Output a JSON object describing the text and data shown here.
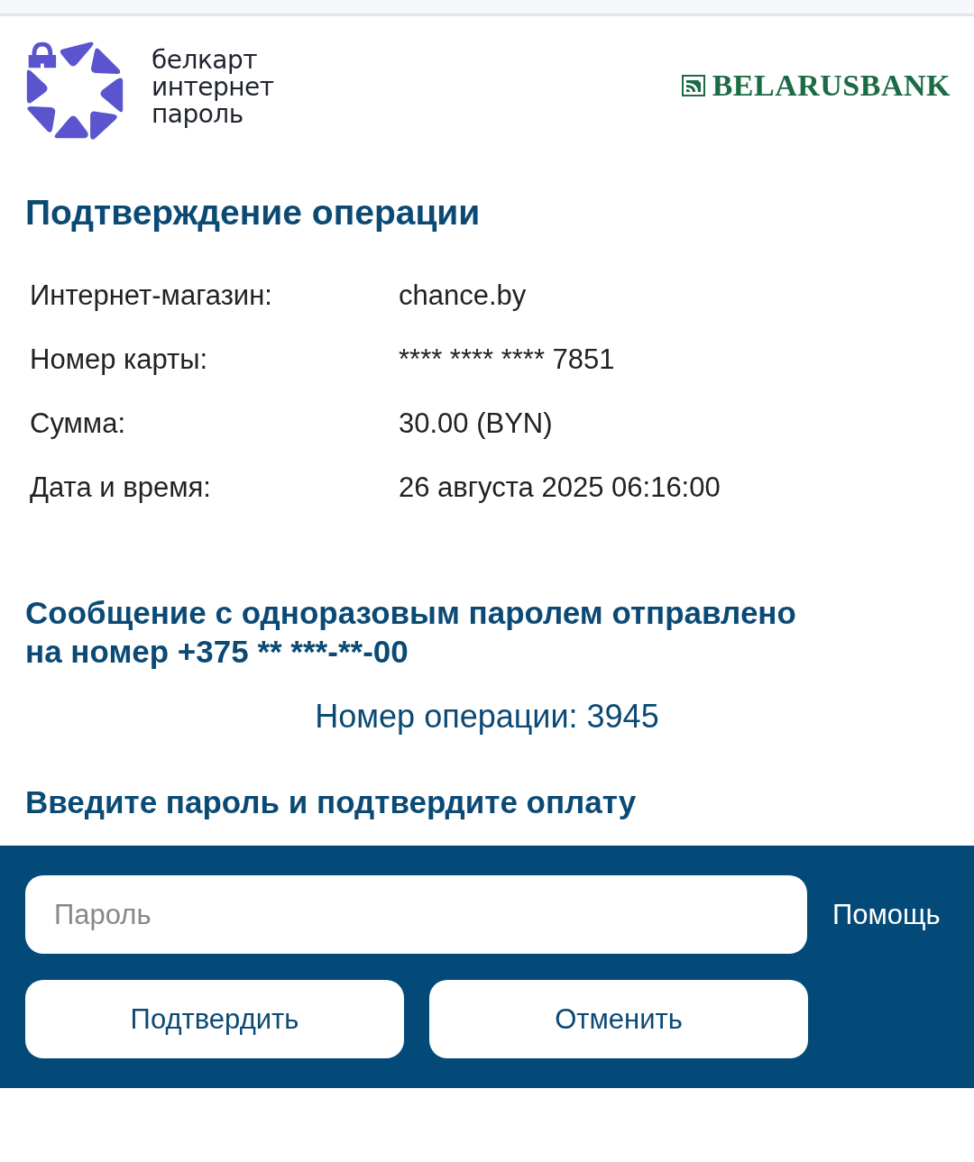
{
  "header": {
    "logo_text": [
      "белкарт",
      "интернет",
      "пароль"
    ],
    "bank_name": "BELARUSBANK"
  },
  "title": "Подтверждение операции",
  "details": [
    {
      "label": "Интернет-магазин:",
      "value": "chance.by"
    },
    {
      "label": "Номер карты:",
      "value": "**** **** **** 7851"
    },
    {
      "label": "Сумма:",
      "value": "30.00 (BYN)"
    },
    {
      "label": "Дата и время:",
      "value": "26 августа 2025 06:16:00"
    }
  ],
  "message": [
    "Сообщение с одноразовым паролем отправлено",
    "на номер +375 ** ***-**-00"
  ],
  "operation_number": "Номер операции: 3945",
  "prompt": "Введите пароль и подтвердите оплату",
  "form": {
    "password": {
      "placeholder": "Пароль"
    },
    "help_link": "Помощь",
    "buttons": [
      "Подтвердить",
      "Отменить"
    ]
  }
}
